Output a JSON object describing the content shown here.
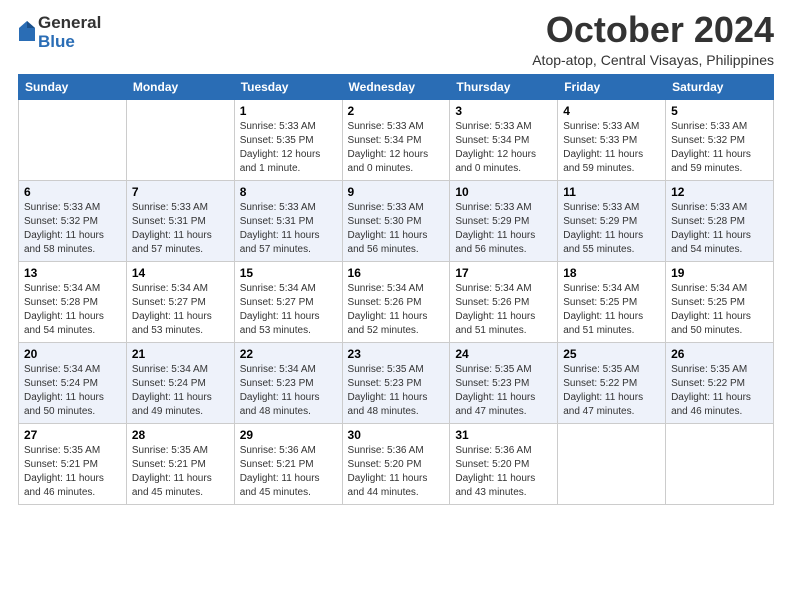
{
  "logo": {
    "general": "General",
    "blue": "Blue"
  },
  "header": {
    "month": "October 2024",
    "location": "Atop-atop, Central Visayas, Philippines"
  },
  "weekdays": [
    "Sunday",
    "Monday",
    "Tuesday",
    "Wednesday",
    "Thursday",
    "Friday",
    "Saturday"
  ],
  "weeks": [
    [
      {
        "day": "",
        "sunrise": "",
        "sunset": "",
        "daylight": "",
        "empty": true
      },
      {
        "day": "",
        "sunrise": "",
        "sunset": "",
        "daylight": "",
        "empty": true
      },
      {
        "day": "1",
        "sunrise": "Sunrise: 5:33 AM",
        "sunset": "Sunset: 5:35 PM",
        "daylight": "Daylight: 12 hours and 1 minute."
      },
      {
        "day": "2",
        "sunrise": "Sunrise: 5:33 AM",
        "sunset": "Sunset: 5:34 PM",
        "daylight": "Daylight: 12 hours and 0 minutes."
      },
      {
        "day": "3",
        "sunrise": "Sunrise: 5:33 AM",
        "sunset": "Sunset: 5:34 PM",
        "daylight": "Daylight: 12 hours and 0 minutes."
      },
      {
        "day": "4",
        "sunrise": "Sunrise: 5:33 AM",
        "sunset": "Sunset: 5:33 PM",
        "daylight": "Daylight: 11 hours and 59 minutes."
      },
      {
        "day": "5",
        "sunrise": "Sunrise: 5:33 AM",
        "sunset": "Sunset: 5:32 PM",
        "daylight": "Daylight: 11 hours and 59 minutes."
      }
    ],
    [
      {
        "day": "6",
        "sunrise": "Sunrise: 5:33 AM",
        "sunset": "Sunset: 5:32 PM",
        "daylight": "Daylight: 11 hours and 58 minutes."
      },
      {
        "day": "7",
        "sunrise": "Sunrise: 5:33 AM",
        "sunset": "Sunset: 5:31 PM",
        "daylight": "Daylight: 11 hours and 57 minutes."
      },
      {
        "day": "8",
        "sunrise": "Sunrise: 5:33 AM",
        "sunset": "Sunset: 5:31 PM",
        "daylight": "Daylight: 11 hours and 57 minutes."
      },
      {
        "day": "9",
        "sunrise": "Sunrise: 5:33 AM",
        "sunset": "Sunset: 5:30 PM",
        "daylight": "Daylight: 11 hours and 56 minutes."
      },
      {
        "day": "10",
        "sunrise": "Sunrise: 5:33 AM",
        "sunset": "Sunset: 5:29 PM",
        "daylight": "Daylight: 11 hours and 56 minutes."
      },
      {
        "day": "11",
        "sunrise": "Sunrise: 5:33 AM",
        "sunset": "Sunset: 5:29 PM",
        "daylight": "Daylight: 11 hours and 55 minutes."
      },
      {
        "day": "12",
        "sunrise": "Sunrise: 5:33 AM",
        "sunset": "Sunset: 5:28 PM",
        "daylight": "Daylight: 11 hours and 54 minutes."
      }
    ],
    [
      {
        "day": "13",
        "sunrise": "Sunrise: 5:34 AM",
        "sunset": "Sunset: 5:28 PM",
        "daylight": "Daylight: 11 hours and 54 minutes."
      },
      {
        "day": "14",
        "sunrise": "Sunrise: 5:34 AM",
        "sunset": "Sunset: 5:27 PM",
        "daylight": "Daylight: 11 hours and 53 minutes."
      },
      {
        "day": "15",
        "sunrise": "Sunrise: 5:34 AM",
        "sunset": "Sunset: 5:27 PM",
        "daylight": "Daylight: 11 hours and 53 minutes."
      },
      {
        "day": "16",
        "sunrise": "Sunrise: 5:34 AM",
        "sunset": "Sunset: 5:26 PM",
        "daylight": "Daylight: 11 hours and 52 minutes."
      },
      {
        "day": "17",
        "sunrise": "Sunrise: 5:34 AM",
        "sunset": "Sunset: 5:26 PM",
        "daylight": "Daylight: 11 hours and 51 minutes."
      },
      {
        "day": "18",
        "sunrise": "Sunrise: 5:34 AM",
        "sunset": "Sunset: 5:25 PM",
        "daylight": "Daylight: 11 hours and 51 minutes."
      },
      {
        "day": "19",
        "sunrise": "Sunrise: 5:34 AM",
        "sunset": "Sunset: 5:25 PM",
        "daylight": "Daylight: 11 hours and 50 minutes."
      }
    ],
    [
      {
        "day": "20",
        "sunrise": "Sunrise: 5:34 AM",
        "sunset": "Sunset: 5:24 PM",
        "daylight": "Daylight: 11 hours and 50 minutes."
      },
      {
        "day": "21",
        "sunrise": "Sunrise: 5:34 AM",
        "sunset": "Sunset: 5:24 PM",
        "daylight": "Daylight: 11 hours and 49 minutes."
      },
      {
        "day": "22",
        "sunrise": "Sunrise: 5:34 AM",
        "sunset": "Sunset: 5:23 PM",
        "daylight": "Daylight: 11 hours and 48 minutes."
      },
      {
        "day": "23",
        "sunrise": "Sunrise: 5:35 AM",
        "sunset": "Sunset: 5:23 PM",
        "daylight": "Daylight: 11 hours and 48 minutes."
      },
      {
        "day": "24",
        "sunrise": "Sunrise: 5:35 AM",
        "sunset": "Sunset: 5:23 PM",
        "daylight": "Daylight: 11 hours and 47 minutes."
      },
      {
        "day": "25",
        "sunrise": "Sunrise: 5:35 AM",
        "sunset": "Sunset: 5:22 PM",
        "daylight": "Daylight: 11 hours and 47 minutes."
      },
      {
        "day": "26",
        "sunrise": "Sunrise: 5:35 AM",
        "sunset": "Sunset: 5:22 PM",
        "daylight": "Daylight: 11 hours and 46 minutes."
      }
    ],
    [
      {
        "day": "27",
        "sunrise": "Sunrise: 5:35 AM",
        "sunset": "Sunset: 5:21 PM",
        "daylight": "Daylight: 11 hours and 46 minutes."
      },
      {
        "day": "28",
        "sunrise": "Sunrise: 5:35 AM",
        "sunset": "Sunset: 5:21 PM",
        "daylight": "Daylight: 11 hours and 45 minutes."
      },
      {
        "day": "29",
        "sunrise": "Sunrise: 5:36 AM",
        "sunset": "Sunset: 5:21 PM",
        "daylight": "Daylight: 11 hours and 45 minutes."
      },
      {
        "day": "30",
        "sunrise": "Sunrise: 5:36 AM",
        "sunset": "Sunset: 5:20 PM",
        "daylight": "Daylight: 11 hours and 44 minutes."
      },
      {
        "day": "31",
        "sunrise": "Sunrise: 5:36 AM",
        "sunset": "Sunset: 5:20 PM",
        "daylight": "Daylight: 11 hours and 43 minutes."
      },
      {
        "day": "",
        "sunrise": "",
        "sunset": "",
        "daylight": "",
        "empty": true
      },
      {
        "day": "",
        "sunrise": "",
        "sunset": "",
        "daylight": "",
        "empty": true
      }
    ]
  ]
}
